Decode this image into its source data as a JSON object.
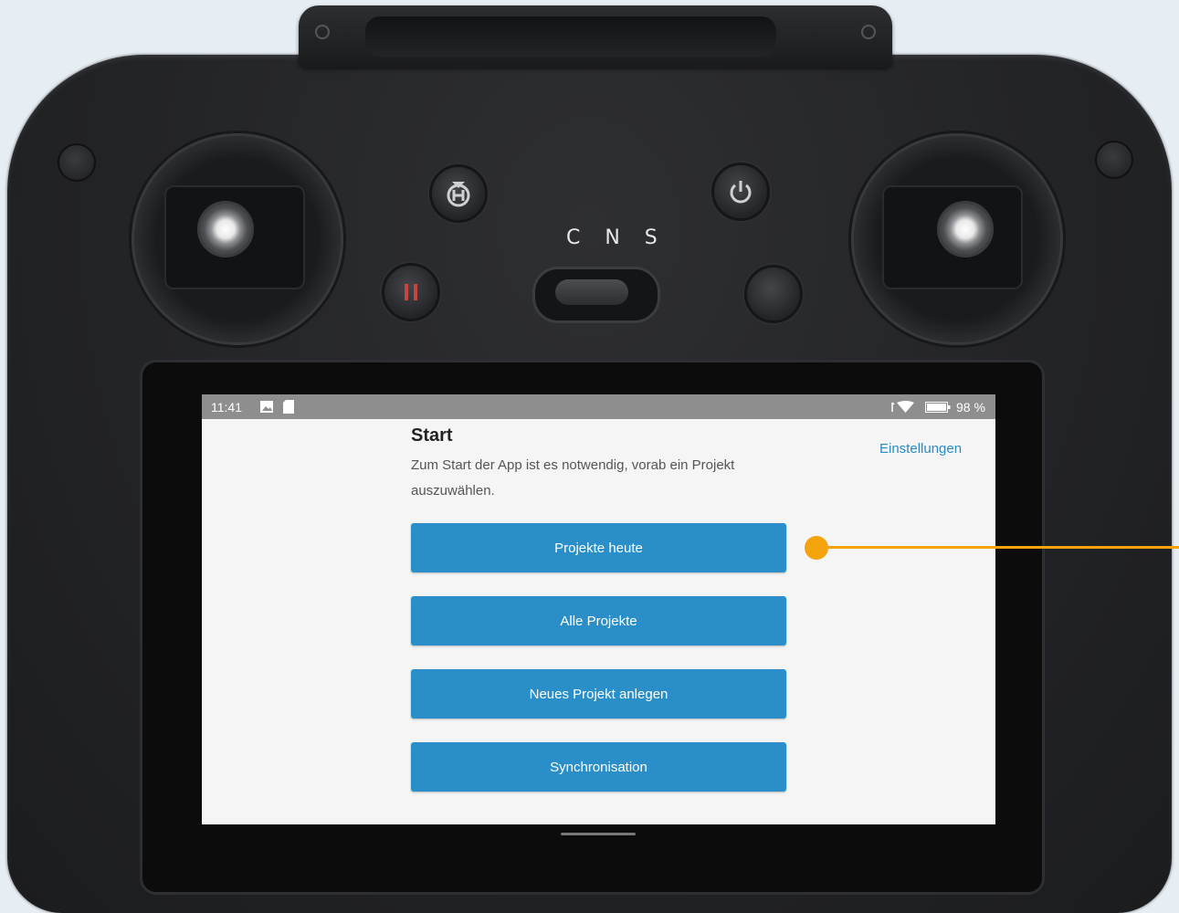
{
  "device": {
    "mode_switch_labels": "C N S",
    "buttons": [
      "home-return-icon",
      "power-icon",
      "pause-icon"
    ]
  },
  "statusbar": {
    "time": "11:41",
    "battery": "98 %"
  },
  "app": {
    "title": "Start",
    "description": "Zum Start der App ist es notwendig, vorab ein Projekt auszuwählen.",
    "settings_link": "Einstellungen",
    "buttons": [
      {
        "label": "Projekte heute"
      },
      {
        "label": "Alle Projekte"
      },
      {
        "label": "Neues Projekt anlegen"
      },
      {
        "label": "Synchronisation"
      }
    ]
  },
  "colors": {
    "button": "#2a8fc9",
    "link": "#2a8bc6",
    "callout": "#f5a30d",
    "statusbar": "#8e8e8e"
  }
}
